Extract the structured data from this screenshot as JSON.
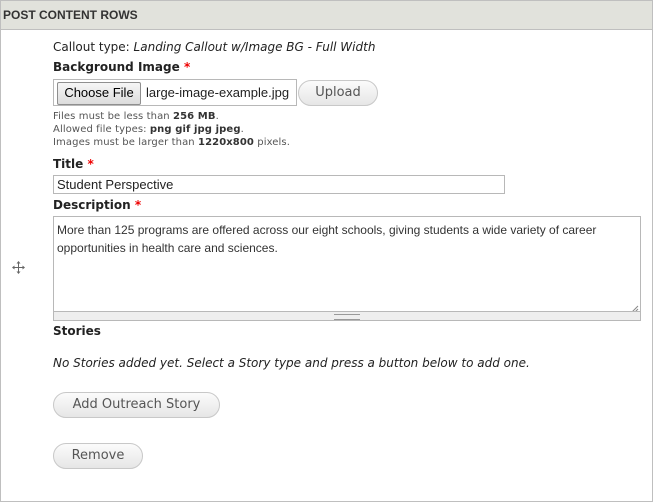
{
  "section": {
    "title": "POST CONTENT ROWS"
  },
  "callout": {
    "label": "Callout type:",
    "value": "Landing Callout w/Image BG - Full Width"
  },
  "background_image": {
    "label": "Background Image",
    "required_mark": "*",
    "choose_file_label": "Choose File",
    "file_name": "large-image-example.jpg",
    "upload_label": "Upload",
    "help": {
      "size_prefix": "Files must be less than ",
      "size_value": "256 MB",
      "size_suffix": ".",
      "types_prefix": "Allowed file types: ",
      "types_value": "png gif jpg jpeg",
      "types_suffix": ".",
      "dims_prefix": "Images must be larger than ",
      "dims_value": "1220x800",
      "dims_suffix": " pixels."
    }
  },
  "title_field": {
    "label": "Title",
    "required_mark": "*",
    "value": "Student Perspective"
  },
  "description_field": {
    "label": "Description",
    "required_mark": "*",
    "value": "More than 125 programs are offered across our eight schools, giving students a wide variety of career opportunities in health care and sciences."
  },
  "stories": {
    "label": "Stories",
    "empty_message": "No Stories added yet. Select a Story type and press a button below to add one.",
    "add_button_label": "Add Outreach Story"
  },
  "remove_button_label": "Remove",
  "icons": {
    "drag": "move-arrows-icon",
    "resize": "resize-corner-icon"
  },
  "colors": {
    "header_bg": "#e1e2dc",
    "required": "#ee0000",
    "border": "#bfbfbf"
  }
}
